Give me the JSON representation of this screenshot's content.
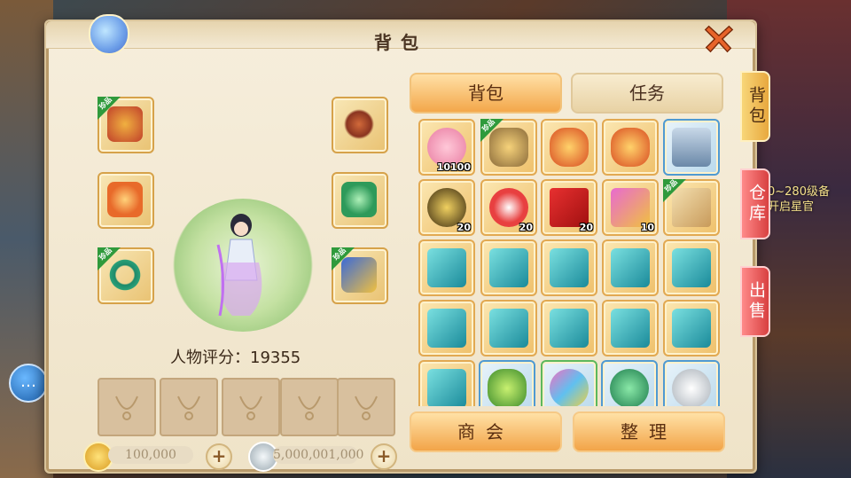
{
  "background": {
    "bg_text_1": "0~280级备",
    "bg_text_2": "开启星官"
  },
  "panel": {
    "title": "背包",
    "score_label": "人物评分：19355"
  },
  "tabs": {
    "bag": "背包",
    "task": "任务"
  },
  "side_tabs": {
    "bag": "背包",
    "warehouse": "仓库",
    "sell": "出售"
  },
  "equipment": {
    "tag_text": "珍品",
    "slots": [
      {
        "name": "helmet",
        "tagged": true
      },
      {
        "name": "necklace",
        "tagged": false
      },
      {
        "name": "weapon",
        "tagged": false
      },
      {
        "name": "armor",
        "tagged": false
      },
      {
        "name": "belt",
        "tagged": true
      },
      {
        "name": "boots",
        "tagged": true
      }
    ]
  },
  "currency": {
    "gold": "100,000",
    "silver": "5,000,001,000",
    "plus": "+"
  },
  "inventory": {
    "counts": {
      "pig": "10100",
      "gold_piece": "20",
      "yin_yang": "20",
      "gift": "20",
      "chest_box": "10"
    }
  },
  "actions": {
    "guild": "商会",
    "sort": "整理"
  },
  "colors": {
    "accent": "#f2a448",
    "panel_bg": "#f3e9d3",
    "tag_green": "#2f9a3c",
    "side_red": "#d84040"
  }
}
